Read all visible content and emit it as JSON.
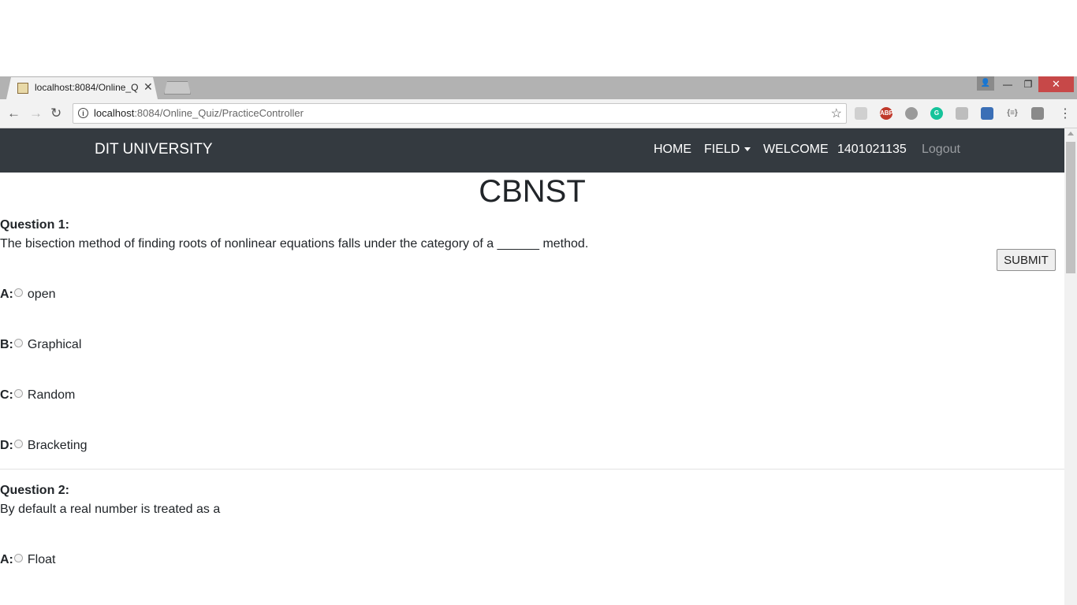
{
  "browser": {
    "tab_title": "localhost:8084/Online_Quiz/PracticeController",
    "url_host": "localhost",
    "url_rest": ":8084/Online_Quiz/PracticeController"
  },
  "site": {
    "brand": "DIT UNIVERSITY",
    "nav": {
      "home": "HOME",
      "field": "FIELD",
      "welcome": "WELCOME",
      "user_id": "1401021135",
      "logout": "Logout"
    }
  },
  "quiz": {
    "title": "CBNST",
    "submit_label": "SUBMIT",
    "questions": [
      {
        "label": "Question 1:",
        "text": "The bisection method of finding roots of nonlinear equations falls under the category of a ______ method.",
        "options": [
          {
            "letter": "A:",
            "text": "open"
          },
          {
            "letter": "B:",
            "text": "Graphical"
          },
          {
            "letter": "C:",
            "text": "Random"
          },
          {
            "letter": "D:",
            "text": "Bracketing"
          }
        ]
      },
      {
        "label": "Question 2:",
        "text": "By default a real number is treated as a",
        "options": [
          {
            "letter": "A:",
            "text": "Float"
          }
        ]
      }
    ]
  },
  "colors": {
    "navbar_bg": "#343a40",
    "logout_text": "#9a9da1",
    "window_close": "#c74848"
  }
}
